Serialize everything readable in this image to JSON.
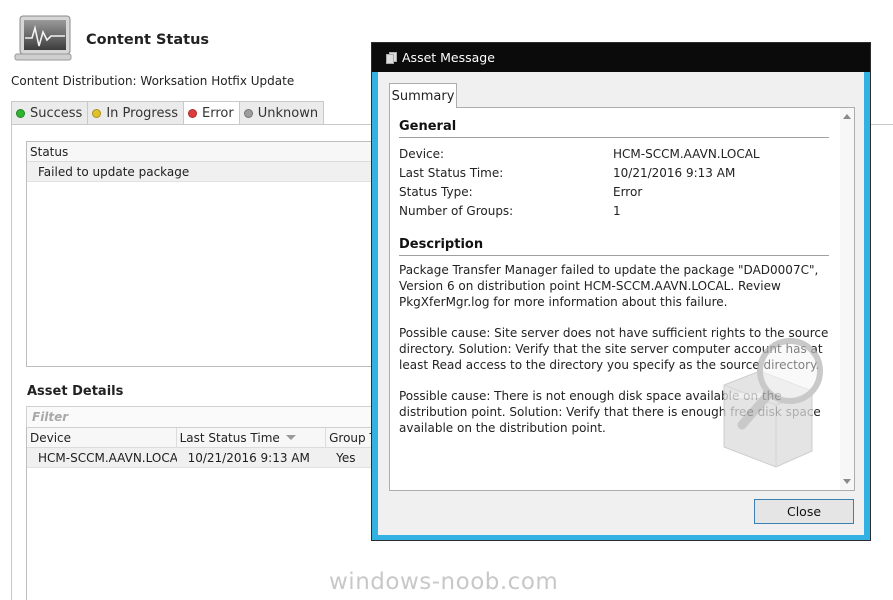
{
  "window": {
    "title": "Content Status",
    "subtitle": "Content Distribution: Worksation Hotfix Update"
  },
  "tabs": [
    {
      "label": "Success",
      "color": "#2fb52f"
    },
    {
      "label": "In Progress",
      "color": "#e2c22a"
    },
    {
      "label": "Error",
      "color": "#e03c3c"
    },
    {
      "label": "Unknown",
      "color": "#9e9e9e"
    }
  ],
  "status_panel": {
    "column": "Status",
    "rows": [
      "Failed to update package"
    ]
  },
  "asset_details": {
    "title": "Asset Details",
    "filter_placeholder": "Filter",
    "columns": [
      "Device",
      "Last Status Time",
      "Group T"
    ],
    "rows": [
      {
        "device": "HCM-SCCM.AAVN.LOCAL",
        "last_status_time": "10/21/2016 9:13 AM",
        "group": "Yes"
      }
    ]
  },
  "dialog": {
    "title": "Asset Message",
    "tab": "Summary",
    "general": {
      "heading": "General",
      "fields": [
        {
          "label": "Device:",
          "value": "HCM-SCCM.AAVN.LOCAL"
        },
        {
          "label": "Last Status Time:",
          "value": "10/21/2016 9:13 AM"
        },
        {
          "label": "Status Type:",
          "value": "Error"
        },
        {
          "label": "Number of Groups:",
          "value": "1"
        }
      ]
    },
    "description": {
      "heading": "Description",
      "paragraphs": [
        "Package Transfer Manager failed to update the package \"DAD0007C\", Version 6 on distribution point HCM-SCCM.AAVN.LOCAL. Review PkgXferMgr.log for more information about this failure.",
        "Possible cause: Site server does not have sufficient rights to the source directory. Solution: Verify that the site server computer account has at least Read access to the directory you specify as the source directory.",
        "Possible cause: There is not enough disk space available on the distribution point. Solution: Verify that there is enough free disk space available on the distribution point."
      ]
    },
    "close_label": "Close"
  },
  "watermark": "windows-noob.com"
}
